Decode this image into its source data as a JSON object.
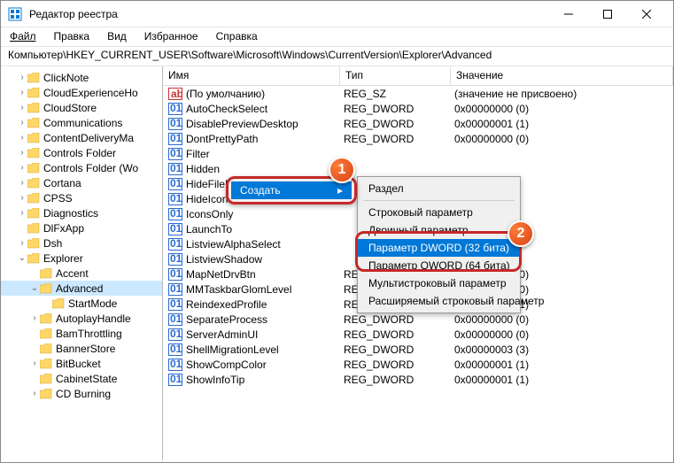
{
  "window": {
    "title": "Редактор реестра"
  },
  "menu": {
    "file": "Файл",
    "edit": "Правка",
    "view": "Вид",
    "fav": "Избранное",
    "help": "Справка"
  },
  "path": "Компьютер\\HKEY_CURRENT_USER\\Software\\Microsoft\\Windows\\CurrentVersion\\Explorer\\Advanced",
  "tree": [
    {
      "d": 1,
      "e": ">",
      "l": "ClickNote"
    },
    {
      "d": 1,
      "e": ">",
      "l": "CloudExperienceHo"
    },
    {
      "d": 1,
      "e": ">",
      "l": "CloudStore"
    },
    {
      "d": 1,
      "e": ">",
      "l": "Communications"
    },
    {
      "d": 1,
      "e": ">",
      "l": "ContentDeliveryMa"
    },
    {
      "d": 1,
      "e": ">",
      "l": "Controls Folder"
    },
    {
      "d": 1,
      "e": ">",
      "l": "Controls Folder (Wo"
    },
    {
      "d": 1,
      "e": ">",
      "l": "Cortana"
    },
    {
      "d": 1,
      "e": ">",
      "l": "CPSS"
    },
    {
      "d": 1,
      "e": ">",
      "l": "Diagnostics"
    },
    {
      "d": 1,
      "e": "",
      "l": "DlFxApp"
    },
    {
      "d": 1,
      "e": ">",
      "l": "Dsh"
    },
    {
      "d": 1,
      "e": "v",
      "l": "Explorer"
    },
    {
      "d": 2,
      "e": "",
      "l": "Accent"
    },
    {
      "d": 2,
      "e": "v",
      "l": "Advanced",
      "sel": true
    },
    {
      "d": 3,
      "e": "",
      "l": "StartMode"
    },
    {
      "d": 2,
      "e": ">",
      "l": "AutoplayHandle"
    },
    {
      "d": 2,
      "e": "",
      "l": "BamThrottling"
    },
    {
      "d": 2,
      "e": "",
      "l": "BannerStore"
    },
    {
      "d": 2,
      "e": ">",
      "l": "BitBucket"
    },
    {
      "d": 2,
      "e": "",
      "l": "CabinetState"
    },
    {
      "d": 2,
      "e": ">",
      "l": "CD Burning"
    }
  ],
  "cols": {
    "name": "Имя",
    "type": "Тип",
    "value": "Значение"
  },
  "rows": [
    {
      "i": "s",
      "n": "(По умолчанию)",
      "t": "REG_SZ",
      "v": "(значение не присвоено)"
    },
    {
      "i": "n",
      "n": "AutoCheckSelect",
      "t": "REG_DWORD",
      "v": "0x00000000 (0)"
    },
    {
      "i": "n",
      "n": "DisablePreviewDesktop",
      "t": "REG_DWORD",
      "v": "0x00000001 (1)"
    },
    {
      "i": "n",
      "n": "DontPrettyPath",
      "t": "REG_DWORD",
      "v": "0x00000000 (0)"
    },
    {
      "i": "n",
      "n": "Filter",
      "t": "",
      "v": ""
    },
    {
      "i": "n",
      "n": "Hidden",
      "t": "",
      "v": ""
    },
    {
      "i": "n",
      "n": "HideFileExt",
      "t": "",
      "v": ""
    },
    {
      "i": "n",
      "n": "HideIcons",
      "t": "",
      "v": ""
    },
    {
      "i": "n",
      "n": "IconsOnly",
      "t": "",
      "v": ""
    },
    {
      "i": "n",
      "n": "LaunchTo",
      "t": "",
      "v": ""
    },
    {
      "i": "n",
      "n": "ListviewAlphaSelect",
      "t": "",
      "v": ""
    },
    {
      "i": "n",
      "n": "ListviewShadow",
      "t": "",
      "v": ""
    },
    {
      "i": "n",
      "n": "MapNetDrvBtn",
      "t": "REG_DWORD",
      "v": "0x00000000 (0)"
    },
    {
      "i": "n",
      "n": "MMTaskbarGlomLevel",
      "t": "REG_DWORD",
      "v": "0x00000000 (0)"
    },
    {
      "i": "n",
      "n": "ReindexedProfile",
      "t": "REG_DWORD",
      "v": "0x00000001 (1)"
    },
    {
      "i": "n",
      "n": "SeparateProcess",
      "t": "REG_DWORD",
      "v": "0x00000000 (0)"
    },
    {
      "i": "n",
      "n": "ServerAdminUI",
      "t": "REG_DWORD",
      "v": "0x00000000 (0)"
    },
    {
      "i": "n",
      "n": "ShellMigrationLevel",
      "t": "REG_DWORD",
      "v": "0x00000003 (3)"
    },
    {
      "i": "n",
      "n": "ShowCompColor",
      "t": "REG_DWORD",
      "v": "0x00000001 (1)"
    },
    {
      "i": "n",
      "n": "ShowInfoTip",
      "t": "REG_DWORD",
      "v": "0x00000001 (1)"
    }
  ],
  "ctx1": {
    "create": "Создать"
  },
  "ctx2": {
    "key": "Раздел",
    "string": "Строковый параметр",
    "binary": "Двоичный параметр",
    "dword": "Параметр DWORD (32 бита)",
    "qword": "Параметр QWORD (64 бита)",
    "multi": "Мультистроковый параметр",
    "expand": "Расширяемый строковый параметр"
  },
  "badges": {
    "b1": "1",
    "b2": "2"
  }
}
